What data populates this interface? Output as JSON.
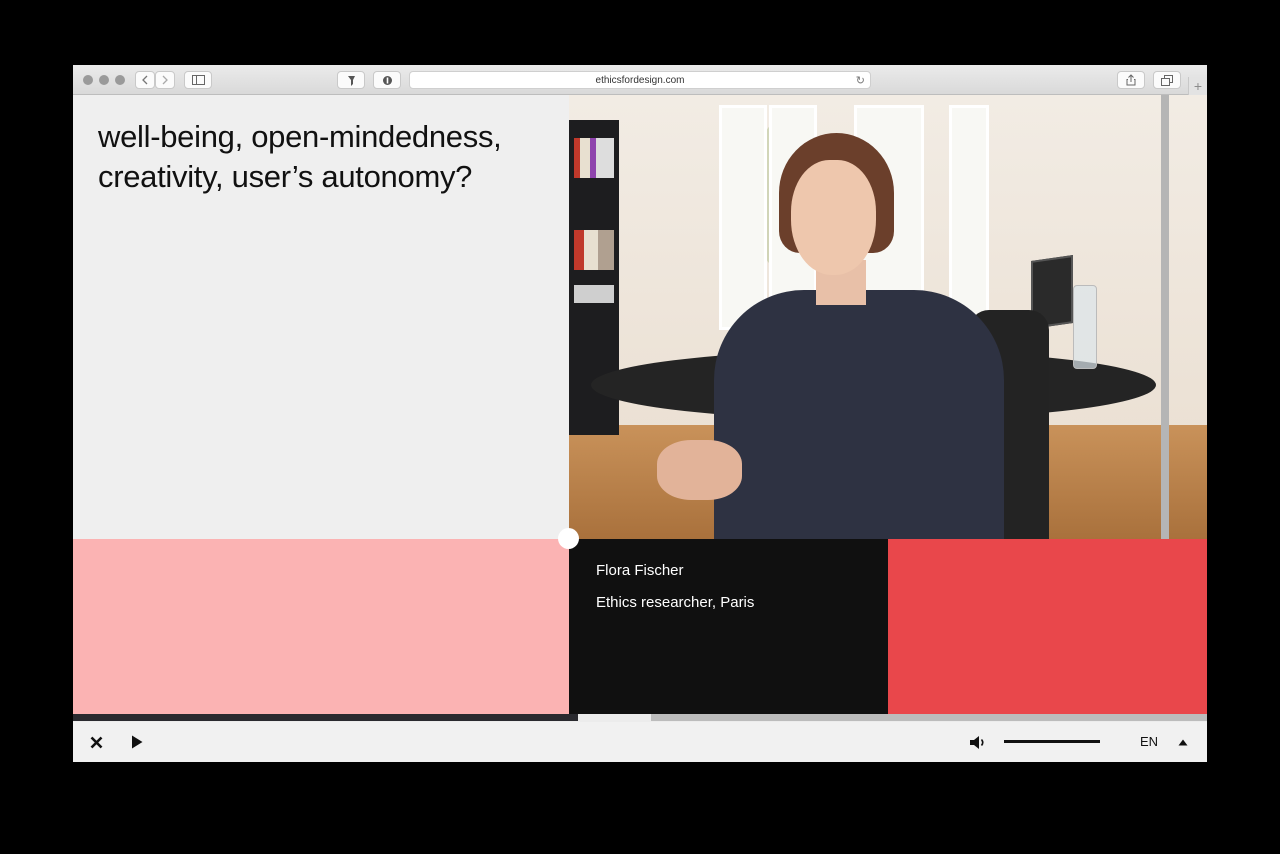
{
  "browser": {
    "url": "ethicsfordesign.com",
    "new_tab_label": "+"
  },
  "content": {
    "quote_line1": "well-being, open-mindedness,",
    "quote_line2": "creativity, user’s autonomy?"
  },
  "caption": {
    "name": "Flora Fischer",
    "role": "Ethics researcher, Paris"
  },
  "player": {
    "language": "EN",
    "progress_played": 0.445,
    "progress_buffered_start": 0.51,
    "volume": 1.0
  },
  "colors": {
    "pink_panel": "#fbb3b3",
    "caption_panel": "#101010",
    "red_panel": "#e9474b",
    "text_panel": "#efefef"
  },
  "icons": {
    "close": "close-icon",
    "play": "play-icon",
    "volume": "speaker-icon",
    "language_menu": "caret-up-icon"
  }
}
